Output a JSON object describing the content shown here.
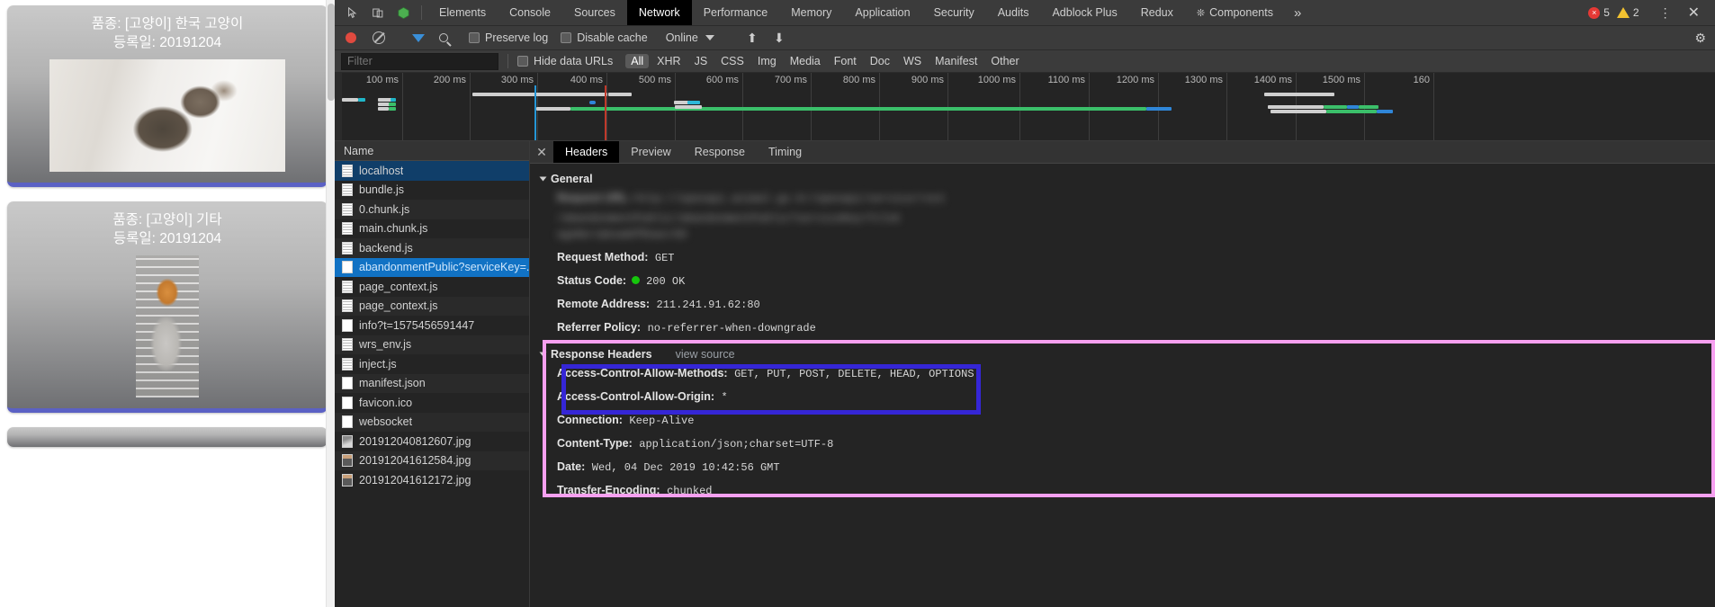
{
  "page": {
    "cards": [
      {
        "breed_label": "품종: [고양이] 한국 고양이",
        "reg_label": "등록일: 20191204",
        "photo": "kitten-tabby"
      },
      {
        "breed_label": "품종: [고양이] 기타",
        "reg_label": "등록일: 20191204",
        "photo": "kitten-orange-cage"
      }
    ]
  },
  "devtools": {
    "main_tabs": [
      {
        "label": "Elements",
        "active": false
      },
      {
        "label": "Console",
        "active": false
      },
      {
        "label": "Sources",
        "active": false
      },
      {
        "label": "Network",
        "active": true
      },
      {
        "label": "Performance",
        "active": false
      },
      {
        "label": "Memory",
        "active": false
      },
      {
        "label": "Application",
        "active": false
      },
      {
        "label": "Security",
        "active": false
      },
      {
        "label": "Audits",
        "active": false
      },
      {
        "label": "Adblock Plus",
        "active": false
      },
      {
        "label": "Redux",
        "active": false
      },
      {
        "label": "Components",
        "active": false
      }
    ],
    "more_tabs_glyph": "»",
    "error_count": "5",
    "warning_count": "2",
    "error_glyph": "×",
    "kebab_glyph": "⋮",
    "close_glyph": "✕",
    "toolbar": {
      "preserve_log_label": "Preserve log",
      "disable_cache_label": "Disable cache",
      "throttling_value": "Online",
      "import_glyph": "⬆",
      "export_glyph": "⬇",
      "gear_glyph": "⚙"
    },
    "filter_bar": {
      "placeholder": "Filter",
      "value": "",
      "hide_data_urls_label": "Hide data URLs",
      "types": [
        "All",
        "XHR",
        "JS",
        "CSS",
        "Img",
        "Media",
        "Font",
        "Doc",
        "WS",
        "Manifest",
        "Other"
      ],
      "active_type": "All"
    },
    "overview": {
      "ticks": [
        "100 ms",
        "200 ms",
        "300 ms",
        "400 ms",
        "500 ms",
        "600 ms",
        "700 ms",
        "800 ms",
        "900 ms",
        "1000 ms",
        "1100 ms",
        "1200 ms",
        "1300 ms",
        "1400 ms",
        "1500 ms",
        "160"
      ],
      "dom_content_loaded_color": "#2596d6",
      "load_event_color": "#c0392b"
    },
    "request_list": {
      "column_header": "Name",
      "rows": [
        {
          "name": "localhost",
          "icon": "document-icon",
          "state": "selected-blue"
        },
        {
          "name": "bundle.js",
          "icon": "script-icon",
          "state": "normal"
        },
        {
          "name": "0.chunk.js",
          "icon": "script-icon",
          "state": "normal"
        },
        {
          "name": "main.chunk.js",
          "icon": "script-icon",
          "state": "normal"
        },
        {
          "name": "backend.js",
          "icon": "script-icon",
          "state": "normal"
        },
        {
          "name": "abandonmentPublic?serviceKey=.",
          "icon": "xhr-icon",
          "state": "selected-bright"
        },
        {
          "name": "page_context.js",
          "icon": "script-icon",
          "state": "normal"
        },
        {
          "name": "page_context.js",
          "icon": "script-icon",
          "state": "normal"
        },
        {
          "name": "info?t=1575456591447",
          "icon": "xhr-icon",
          "state": "normal"
        },
        {
          "name": "wrs_env.js",
          "icon": "script-icon",
          "state": "normal"
        },
        {
          "name": "inject.js",
          "icon": "script-icon",
          "state": "normal"
        },
        {
          "name": "manifest.json",
          "icon": "manifest-icon",
          "state": "normal"
        },
        {
          "name": "favicon.ico",
          "icon": "image-icon",
          "state": "normal"
        },
        {
          "name": "websocket",
          "icon": "websocket-icon",
          "state": "normal"
        },
        {
          "name": "201912040812607.jpg",
          "icon": "image-thumb-icon",
          "state": "normal"
        },
        {
          "name": "201912041612584.jpg",
          "icon": "image-thumb-icon",
          "state": "normal"
        },
        {
          "name": "201912041612172.jpg",
          "icon": "image-thumb-icon",
          "state": "normal"
        }
      ]
    },
    "detail": {
      "tabs": [
        {
          "label": "Headers",
          "active": true
        },
        {
          "label": "Preview",
          "active": false
        },
        {
          "label": "Response",
          "active": false
        },
        {
          "label": "Timing",
          "active": false
        }
      ],
      "close_glyph": "✕",
      "general": {
        "title": "General",
        "request_url_key": "Request URL:",
        "request_url_value_blurred_1": "http://openapi.animal.go.kr/openapi/service/rest",
        "request_url_value_blurred_2": "/abandonmentPublic/abandonmentPublic?serviceKey=Tclok",
        "request_url_value_blurred_3": "ageNo=1&numOfRows=50",
        "rows": [
          {
            "key": "Request Method:",
            "value": "GET"
          },
          {
            "key": "Status Code:",
            "value": "200  OK",
            "has_status_dot": true
          },
          {
            "key": "Remote Address:",
            "value": "211.241.91.62:80"
          },
          {
            "key": "Referrer Policy:",
            "value": "no-referrer-when-downgrade"
          }
        ]
      },
      "response_headers": {
        "title": "Response Headers",
        "view_source_label": "view source",
        "rows": [
          {
            "key": "Access-Control-Allow-Methods:",
            "value": "GET, PUT, POST, DELETE, HEAD, OPTIONS",
            "highlight": true
          },
          {
            "key": "Access-Control-Allow-Origin:",
            "value": "*",
            "highlight": true
          },
          {
            "key": "Connection:",
            "value": "Keep-Alive",
            "highlight": false
          },
          {
            "key": "Content-Type:",
            "value": "application/json;charset=UTF-8",
            "highlight": false
          },
          {
            "key": "Date:",
            "value": "Wed, 04 Dec 2019 10:42:56 GMT",
            "highlight": false
          },
          {
            "key": "Transfer-Encoding:",
            "value": "chunked",
            "highlight": false
          }
        ]
      }
    },
    "annotations": {
      "pink_box_color": "#f7a0f0",
      "blue_box_color": "#3526d6"
    }
  }
}
